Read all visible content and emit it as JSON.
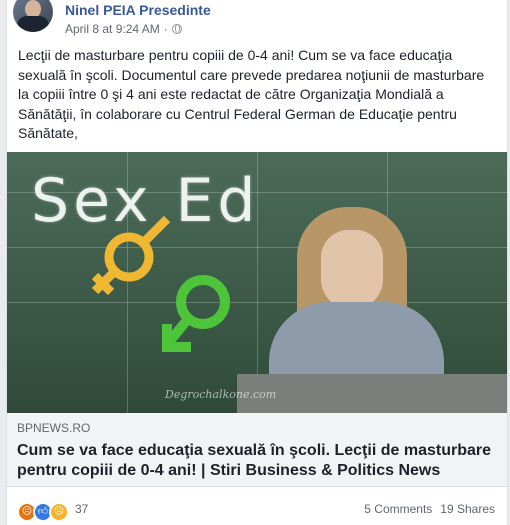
{
  "post": {
    "author": "Ninel PEIA Presedinte",
    "timestamp": "April 8 at 9:24 AM",
    "privacy_separator": "·",
    "text": "Lecţii de masturbare pentru copiii de 0-4 ani! Cum se va face educaţia sexuală în şcoli. Documentul care prevede predarea noţiunii de masturbare la copiii între 0 şi 4 ani este redactat de către Organizaţia Mondială a Sănătăţii, în colaborare cu Centrul Federal German de Educaţie pentru Sănătate,"
  },
  "image": {
    "board_text": "Sex Ed",
    "watermark": "Degrochalkone.com"
  },
  "link": {
    "domain": "BPNEWS.RO",
    "title": "Cum se va face educaţia sexuală în şcoli. Lecţii de masturbare pentru copiii de 0-4 ani! | Stiri Business & Politics News"
  },
  "footer": {
    "reaction_count": "37",
    "comments": "5 Comments",
    "shares": "19 Shares",
    "reactions": [
      "angry-icon",
      "like-icon",
      "sad-icon"
    ]
  },
  "colors": {
    "author_link": "#385898",
    "link_bg": "#f2f3f5",
    "angry": "#e9710f",
    "like": "#3578e5",
    "sad": "#f7b125"
  }
}
